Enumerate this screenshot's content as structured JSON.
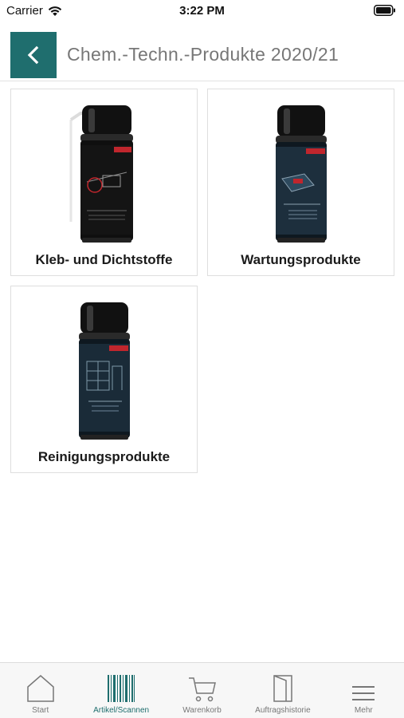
{
  "status_bar": {
    "carrier": "Carrier",
    "time": "3:22 PM"
  },
  "header": {
    "title": "Chem.-Techn.-Produkte 2020/21",
    "back_icon": "chevron-left-icon"
  },
  "categories": [
    {
      "label": "Kleb- und Dichtstoffe"
    },
    {
      "label": "Wartungsprodukte"
    },
    {
      "label": "Reinigungsprodukte"
    }
  ],
  "tabbar": {
    "items": [
      {
        "label": "Start",
        "icon": "home-icon"
      },
      {
        "label": "Artikel/Scannen",
        "icon": "barcode-icon",
        "active": true
      },
      {
        "label": "Warenkorb",
        "icon": "cart-icon"
      },
      {
        "label": "Auftragshistorie",
        "icon": "door-icon"
      },
      {
        "label": "Mehr",
        "icon": "menu-icon"
      }
    ]
  },
  "colors": {
    "accent": "#1f6e6e",
    "can_body": "#0e1820",
    "can_label": "#1d2f3d",
    "stripe": "#c0262d"
  }
}
